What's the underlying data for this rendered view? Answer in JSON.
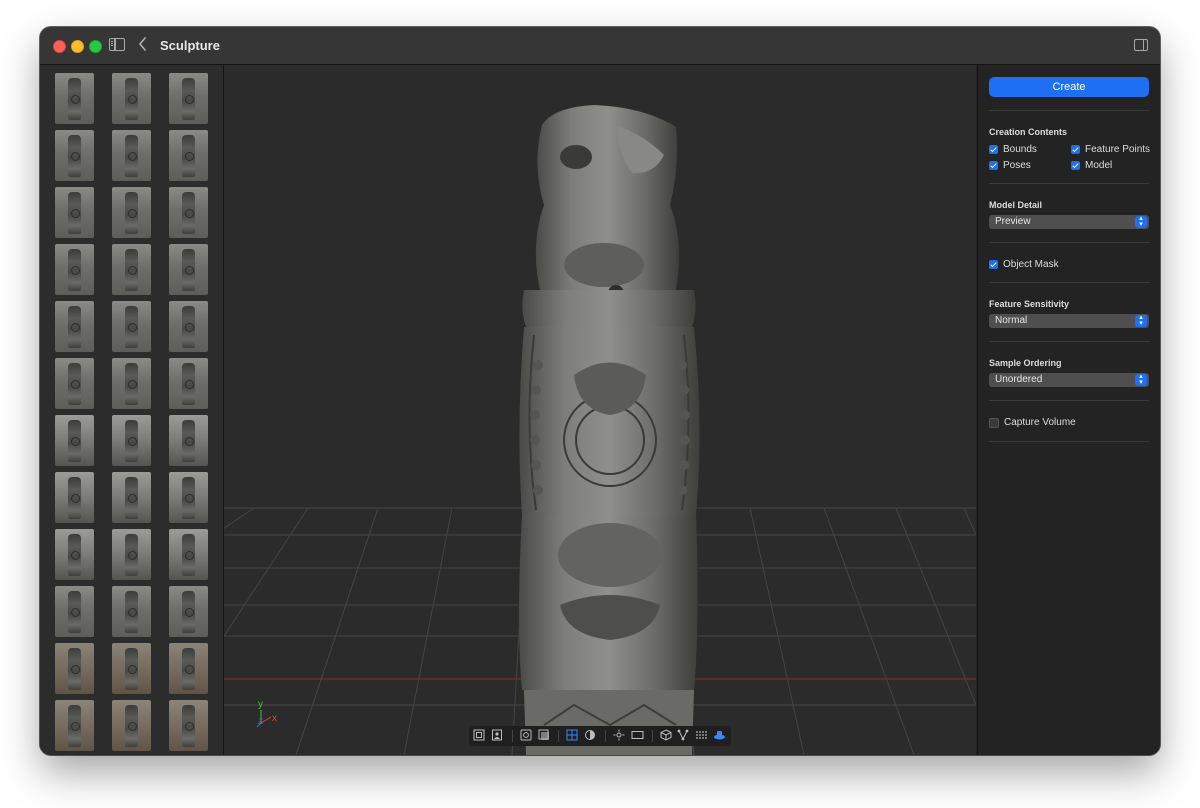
{
  "window": {
    "title": "Sculpture"
  },
  "thumbnails": {
    "count": 39
  },
  "inspector": {
    "create_label": "Create",
    "creation_contents": {
      "title": "Creation Contents",
      "options": [
        {
          "label": "Bounds",
          "checked": true
        },
        {
          "label": "Feature Points",
          "checked": true
        },
        {
          "label": "Poses",
          "checked": true
        },
        {
          "label": "Model",
          "checked": true
        }
      ]
    },
    "model_detail": {
      "title": "Model Detail",
      "value": "Preview"
    },
    "object_mask": {
      "label": "Object Mask",
      "checked": true
    },
    "feature_sensitivity": {
      "title": "Feature Sensitivity",
      "value": "Normal"
    },
    "sample_ordering": {
      "title": "Sample Ordering",
      "value": "Unordered"
    },
    "capture_volume": {
      "label": "Capture Volume",
      "checked": false
    }
  },
  "viewport": {
    "axes": {
      "y": "y",
      "z": "z",
      "x": "x"
    }
  },
  "toolbar": {
    "tools": [
      "frame-icon",
      "photo-icon",
      "sep",
      "object-icon",
      "layers-icon",
      "sep",
      "grid-icon",
      "contrast-icon",
      "sep",
      "light-icon",
      "rect-icon",
      "sep",
      "cube-icon",
      "nodes-icon",
      "dots-grid-icon",
      "platform-icon"
    ]
  },
  "colors": {
    "accent": "#1f6ff2",
    "window_bg": "#232323",
    "titlebar": "#363636"
  }
}
